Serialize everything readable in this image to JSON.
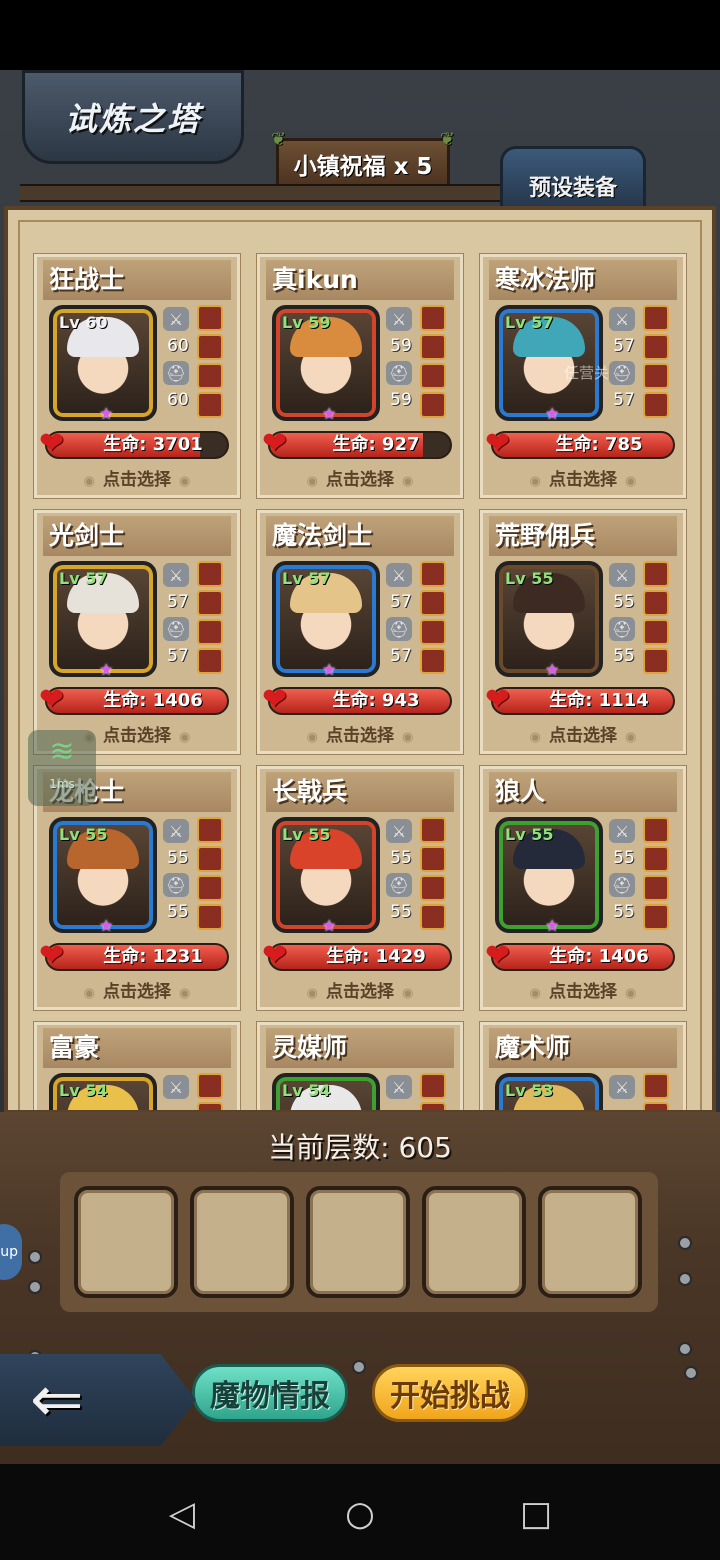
{
  "header": {
    "title": "试炼之塔",
    "blessing": "小镇祝福 x 5",
    "preset_tab": "预设装备"
  },
  "heroes": [
    {
      "name": "狂战士",
      "lv": "Lv 60",
      "atk": "60",
      "def": "60",
      "hp": "生命: 3701",
      "hp_fraction": 0.85,
      "select": "点击选择",
      "frame": "gold",
      "hair": "#e8e8ec"
    },
    {
      "name": "真ikun",
      "lv": "Lv 59",
      "atk": "59",
      "def": "59",
      "hp": "生命: 927",
      "hp_fraction": 0.85,
      "select": "点击选择",
      "frame": "red",
      "hair": "#d98c3e"
    },
    {
      "name": "寒冰法师",
      "lv": "Lv 57",
      "atk": "57",
      "def": "57",
      "hp": "生命: 785",
      "hp_fraction": 1.0,
      "select": "点击选择",
      "frame": "blue",
      "hair": "#3fa7b8"
    },
    {
      "name": "光剑士",
      "lv": "Lv 57",
      "atk": "57",
      "def": "57",
      "hp": "生命: 1406",
      "hp_fraction": 1.0,
      "select": "点击选择",
      "frame": "gold",
      "hair": "#e6e2da"
    },
    {
      "name": "魔法剑士",
      "lv": "Lv 57",
      "atk": "57",
      "def": "57",
      "hp": "生命: 943",
      "hp_fraction": 1.0,
      "select": "点击选择",
      "frame": "blue",
      "hair": "#e5c48a"
    },
    {
      "name": "荒野佣兵",
      "lv": "Lv 55",
      "atk": "55",
      "def": "55",
      "hp": "生命: 1114",
      "hp_fraction": 1.0,
      "select": "点击选择",
      "frame": "brown",
      "hair": "#3d2a22"
    },
    {
      "name": "龙枪士",
      "lv": "Lv 55",
      "atk": "55",
      "def": "55",
      "hp": "生命: 1231",
      "hp_fraction": 1.0,
      "select": "点击选择",
      "frame": "blue",
      "hair": "#b8662e"
    },
    {
      "name": "长戟兵",
      "lv": "Lv 55",
      "atk": "55",
      "def": "55",
      "hp": "生命: 1429",
      "hp_fraction": 1.0,
      "select": "点击选择",
      "frame": "red",
      "hair": "#d8432a"
    },
    {
      "name": "狼人",
      "lv": "Lv 55",
      "atk": "55",
      "def": "55",
      "hp": "生命: 1406",
      "hp_fraction": 1.0,
      "select": "点击选择",
      "frame": "green",
      "hair": "#252a3a"
    },
    {
      "name": "富豪",
      "lv": "Lv 54",
      "frame": "gold",
      "hair": "#e8c04a"
    },
    {
      "name": "灵媒师",
      "lv": "Lv 54",
      "frame": "green",
      "hair": "#e8e8e8"
    },
    {
      "name": "魔术师",
      "lv": "Lv 53",
      "frame": "blue",
      "hair": "#e0b860"
    }
  ],
  "bottom": {
    "floor": "当前层数: 605",
    "monster_info": "魔物情报",
    "start_challenge": "开始挑战"
  },
  "overlays": {
    "wifi_label": "1ms",
    "side_pill": "up",
    "ghost_text": "任营关"
  }
}
